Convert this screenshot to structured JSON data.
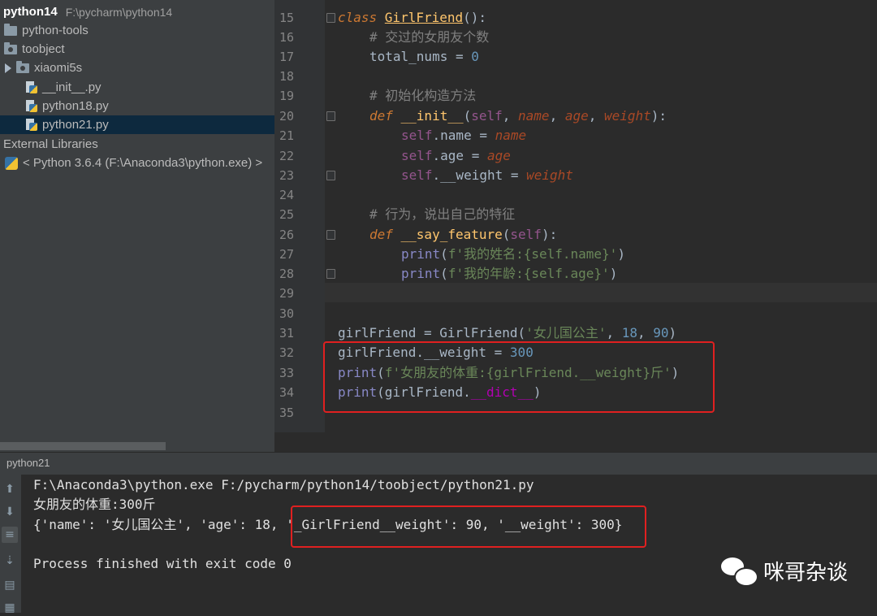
{
  "project": {
    "root_name": "python14",
    "root_path": "F:\\pycharm\\python14",
    "items": [
      {
        "label": "python-tools"
      },
      {
        "label": "toobject"
      },
      {
        "label": "xiaomi5s"
      },
      {
        "label": "__init__.py"
      },
      {
        "label": "python18.py"
      },
      {
        "label": "python21.py"
      }
    ],
    "external_libraries": "External Libraries",
    "sdk": "< Python 3.6.4 (F:\\Anaconda3\\python.exe) >"
  },
  "editor": {
    "line_numbers": [
      "15",
      "16",
      "17",
      "18",
      "19",
      "20",
      "21",
      "22",
      "23",
      "24",
      "25",
      "26",
      "27",
      "28",
      "29",
      "30",
      "31",
      "32",
      "33",
      "34",
      "35"
    ],
    "code": {
      "l15_kw": "class ",
      "l15_name": "GirlFriend",
      "l15_rest": "():",
      "l16": "# 交过的女朋友个数",
      "l17_a": "total_nums = ",
      "l17_b": "0",
      "l19": "# 初始化构造方法",
      "l20_kw": "def ",
      "l20_fn": "__init__",
      "l20_p1": "(",
      "l20_self": "self",
      "l20_c1": ", ",
      "l20_name": "name",
      "l20_c2": ", ",
      "l20_age": "age",
      "l20_c3": ", ",
      "l20_weight": "weight",
      "l20_end": "):",
      "l21_self": "self",
      "l21_a": ".name = ",
      "l21_b": "name",
      "l22_self": "self",
      "l22_a": ".age = ",
      "l22_b": "age",
      "l23_self": "self",
      "l23_a": ".__weight = ",
      "l23_b": "weight",
      "l25": "# 行为，说出自己的特征",
      "l26_kw": "def ",
      "l26_fn": "__say_feature",
      "l26_a": "(",
      "l26_self": "self",
      "l26_b": "):",
      "l27_print": "print",
      "l27_a": "(",
      "l27_str": "f'我的姓名:{self.name}'",
      "l27_b": ")",
      "l28_print": "print",
      "l28_a": "(",
      "l28_str": "f'我的年龄:{self.age}'",
      "l28_b": ")",
      "l31_a": "girlFriend = GirlFriend(",
      "l31_str": "'女儿国公主'",
      "l31_c": ", ",
      "l31_n1": "18",
      "l31_d": ", ",
      "l31_n2": "90",
      "l31_e": ")",
      "l32_a": "girlFriend.__weight = ",
      "l32_n": "300",
      "l33_print": "print",
      "l33_a": "(",
      "l33_str": "f'女朋友的体重:{girlFriend.__weight}斤'",
      "l33_b": ")",
      "l34_print": "print",
      "l34_a": "(girlFriend.",
      "l34_dict": "__dict__",
      "l34_b": ")"
    }
  },
  "run": {
    "tab_label": "python21",
    "output": [
      "F:\\Anaconda3\\python.exe F:/pycharm/python14/toobject/python21.py",
      "女朋友的体重:300斤",
      "{'name': '女儿国公主', 'age': 18, '_GirlFriend__weight': 90, '__weight': 300}",
      "",
      "Process finished with exit code 0"
    ]
  },
  "watermark": {
    "text": "咪哥杂谈",
    "icon": "wechat-icon"
  },
  "colors": {
    "highlight_box": "#e02020",
    "keyword": "#cc7832",
    "function": "#ffc66d",
    "self": "#94558d",
    "number": "#6897bb",
    "string": "#6a8759",
    "comment": "#808080"
  }
}
